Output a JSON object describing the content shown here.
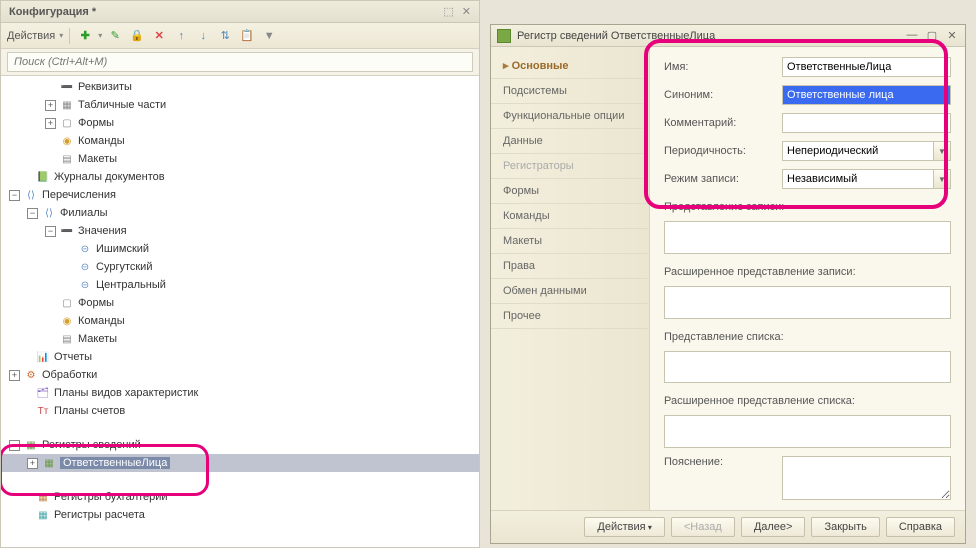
{
  "left": {
    "title": "Конфигурация *",
    "search_placeholder": "Поиск (Ctrl+Alt+M)",
    "toolbar_label": "Действия"
  },
  "tree": {
    "rekvizity": "Реквизиты",
    "tab_chasti": "Табличные части",
    "formy": "Формы",
    "komandy": "Команды",
    "makety": "Макеты",
    "zhurnaly": "Журналы документов",
    "perechisleniya": "Перечисления",
    "filialy": "Филиалы",
    "znacheniya": "Значения",
    "ishimskiy": "Ишимский",
    "surgutskiy": "Сургутский",
    "centralniy": "Центральный",
    "formy2": "Формы",
    "komandy2": "Команды",
    "makety2": "Макеты",
    "otchety": "Отчеты",
    "obrabotki": "Обработки",
    "plany_vidov": "Планы видов характеристик",
    "plany_schetov": "Планы счетов",
    "registry_svedeniy": "Регистры сведений",
    "otv_lica": "ОтветственныеЛица",
    "registry_buh": "Регистры бухгалтерии",
    "registry_rascheta": "Регистры расчета"
  },
  "dialog": {
    "title": "Регистр сведений ОтветственныеЛица",
    "nav": {
      "osnovnye": "Основные",
      "podsistemy": "Подсистемы",
      "func_optsii": "Функциональные опции",
      "dannye": "Данные",
      "registratory": "Регистраторы",
      "formy": "Формы",
      "komandy": "Команды",
      "makety": "Макеты",
      "prava": "Права",
      "obmen": "Обмен данными",
      "prochee": "Прочее"
    },
    "form": {
      "imya_lbl": "Имя:",
      "imya_val": "ОтветственныеЛица",
      "sinonim_lbl": "Синоним:",
      "sinonim_val": "Ответственные лица",
      "kommentariy_lbl": "Комментарий:",
      "kommentariy_val": "",
      "periodichnost_lbl": "Периодичность:",
      "periodichnost_val": "Непериодический",
      "rezhim_lbl": "Режим записи:",
      "rezhim_val": "Независимый",
      "predstavlenie_zapisi": "Представление записи:",
      "rasshirennoe_pred_zapisi": "Расширенное представление записи:",
      "predstavlenie_spiska": "Представление списка:",
      "rasshirennoe_pred_spiska": "Расширенное представление списка:",
      "poyasnenie": "Пояснение:"
    },
    "footer": {
      "deystviya": "Действия",
      "nazad": "<Назад",
      "dalee": "Далее>",
      "zakryt": "Закрыть",
      "spravka": "Справка"
    }
  }
}
